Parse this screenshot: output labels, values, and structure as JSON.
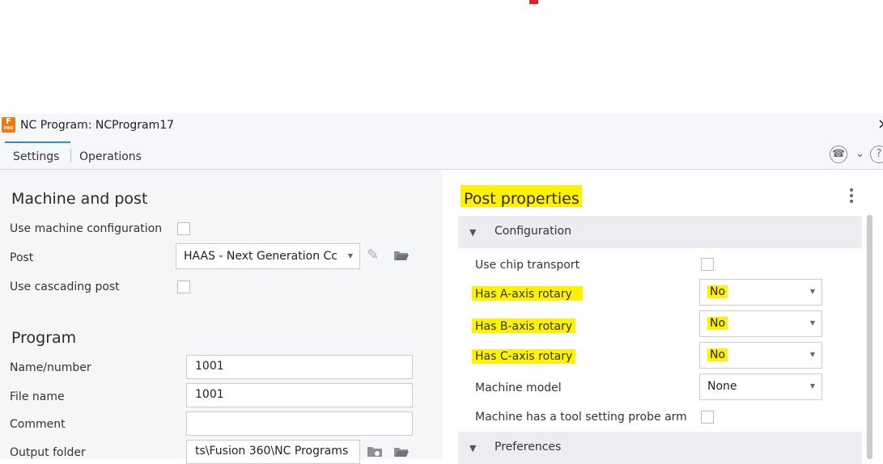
{
  "window": {
    "title": "NC Program: NCProgram17",
    "app_icon_letter": "F",
    "app_icon_sub": "PRO",
    "close_glyph": "×"
  },
  "tabs": [
    {
      "label": "Settings",
      "active": true
    },
    {
      "label": "Operations",
      "active": false
    }
  ],
  "toolbar_icons": [
    "phone-icon",
    "chevron-down-icon",
    "help-icon"
  ],
  "machine_post": {
    "title": "Machine and post",
    "use_machine_config_label": "Use machine configuration",
    "use_machine_config_checked": false,
    "post_label": "Post",
    "post_value": "HAAS - Next Generation Cc",
    "use_cascading_label": "Use cascading post",
    "use_cascading_checked": false
  },
  "program": {
    "title": "Program",
    "name_label": "Name/number",
    "name_value": "1001",
    "file_label": "File name",
    "file_value": "1001",
    "comment_label": "Comment",
    "comment_value": "",
    "output_label": "Output folder",
    "output_value": "ts\\Fusion 360\\NC Programs"
  },
  "post_properties": {
    "title": "Post properties",
    "configuration_group": "Configuration",
    "use_chip_transport_label": "Use chip transport",
    "use_chip_transport_checked": false,
    "has_a_label": "Has A-axis rotary",
    "has_a_value": "No",
    "has_b_label": "Has B-axis rotary",
    "has_b_value": "No",
    "has_c_label": "Has C-axis rotary",
    "has_c_value": "No",
    "machine_model_label": "Machine model",
    "machine_model_value": "None",
    "probe_arm_label": "Machine has a tool setting probe arm",
    "probe_arm_checked": false,
    "preferences_group": "Preferences"
  },
  "colors": {
    "highlight": "#fff200",
    "accent": "#2b8fd6",
    "app_icon": "#f07a10"
  }
}
